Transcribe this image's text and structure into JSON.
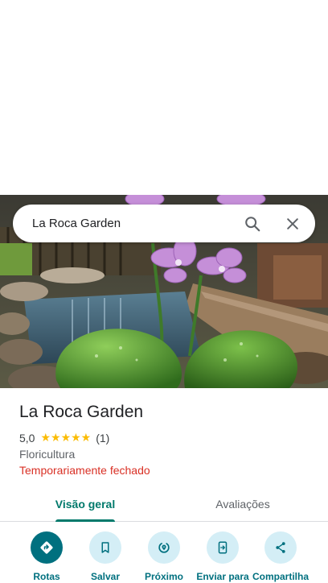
{
  "search": {
    "query": "La Roca Garden"
  },
  "place": {
    "name": "La Roca Garden",
    "rating": "5,0",
    "stars": "★★★★★",
    "review_count": "(1)",
    "category": "Floricultura",
    "status": "Temporariamente fechado"
  },
  "tabs": [
    {
      "label": "Visão geral",
      "active": true
    },
    {
      "label": "Avaliações",
      "active": false
    }
  ],
  "actions": [
    {
      "label": "Rotas",
      "icon": "directions-icon"
    },
    {
      "label": "Salvar",
      "icon": "bookmark-icon"
    },
    {
      "label": "Próximo",
      "icon": "nearby-icon"
    },
    {
      "label": "Enviar para",
      "icon": "send-to-phone-icon"
    },
    {
      "label": "Compartilha",
      "icon": "share-icon"
    }
  ],
  "colors": {
    "accent": "#00707f",
    "accent_light": "#d4eef6",
    "status_closed": "#d93025",
    "stars": "#fbbc04"
  }
}
